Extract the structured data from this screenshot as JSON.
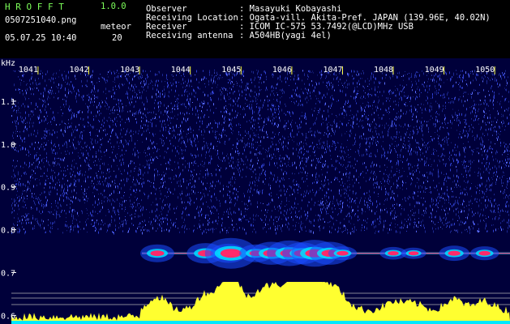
{
  "header": {
    "brand": "H R O F F T",
    "version": "1.0.0",
    "filename": "0507251040.png",
    "meteor_label": "meteor",
    "datetime": "05.07.25 10:40",
    "meteor_count": "20",
    "info": [
      {
        "key": "Observer",
        "value": ": Masayuki Kobayashi"
      },
      {
        "key": "Receiving Location",
        "value": ": Ogata-vill. Akita-Pref. JAPAN (139.96E, 40.02N)"
      },
      {
        "key": "Receiver",
        "value": ": ICOM IC-575 53.7492(@LCD)MHz USB"
      },
      {
        "key": "Receiving antenna",
        "value": ": A504HB(yagi 4el)"
      }
    ]
  },
  "chart_data": {
    "type": "heatmap",
    "y_unit_label": "kHz",
    "y_ticks": [
      "1.1",
      "1.0",
      "0.9",
      "0.8",
      "0.7",
      "0.6"
    ],
    "y_range": [
      0.58,
      1.2
    ],
    "x_ticks": [
      "1041",
      "1042",
      "1043",
      "1044",
      "1045",
      "1046",
      "1047",
      "1048",
      "1049",
      "1050"
    ],
    "x_range": [
      1040.25,
      1050.3
    ],
    "signal_line_khz": 0.745,
    "meteor_events": [
      {
        "minute": 1043.35,
        "strength": 0.5
      },
      {
        "minute": 1044.3,
        "strength": 0.6
      },
      {
        "minute": 1044.75,
        "strength": 0.55
      },
      {
        "minute": 1044.8,
        "strength": 1.0
      },
      {
        "minute": 1045.3,
        "strength": 0.5
      },
      {
        "minute": 1045.6,
        "strength": 0.7
      },
      {
        "minute": 1045.95,
        "strength": 0.8
      },
      {
        "minute": 1046.2,
        "strength": 0.65
      },
      {
        "minute": 1046.45,
        "strength": 0.85
      },
      {
        "minute": 1046.75,
        "strength": 0.7
      },
      {
        "minute": 1047.0,
        "strength": 0.35
      },
      {
        "minute": 1048.0,
        "strength": 0.3
      },
      {
        "minute": 1048.4,
        "strength": 0.25
      },
      {
        "minute": 1049.2,
        "strength": 0.4
      },
      {
        "minute": 1049.8,
        "strength": 0.35
      }
    ],
    "colors": {
      "background": "#00003a",
      "noise": "#3040d0",
      "signal": "#ff2a6a",
      "signal_edge": "#00e0ff",
      "activity": "#ffff30",
      "baseline": "#00e8ff",
      "tick": "#ffffff",
      "label": "#ffff40"
    }
  }
}
